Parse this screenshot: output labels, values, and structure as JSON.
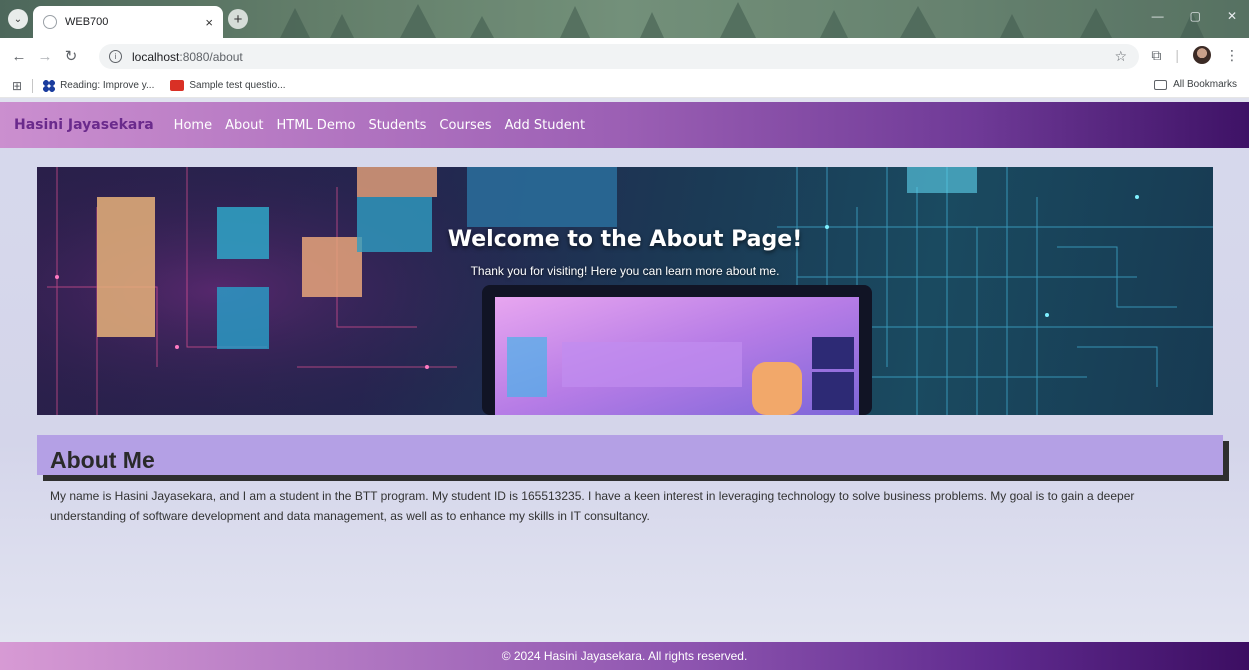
{
  "browser": {
    "tab_title": "WEB700",
    "tab_close": "×",
    "new_tab": "+",
    "url_host": "localhost",
    "url_path": ":8080/about",
    "bookmarks": [
      "Reading: Improve y...",
      "Sample test questio..."
    ],
    "all_bookmarks": "All Bookmarks"
  },
  "navbar": {
    "brand": "Hasini Jayasekara",
    "links": [
      "Home",
      "About",
      "HTML Demo",
      "Students",
      "Courses",
      "Add Student"
    ]
  },
  "hero": {
    "title": "Welcome to the About Page!",
    "subtitle": "Thank you for visiting! Here you can learn more about me."
  },
  "about": {
    "heading": "About Me",
    "text": "My name is Hasini Jayasekara, and I am a student in the BTT program. My student ID is 165513235. I have a keen interest in leveraging technology to solve business problems. My goal is to gain a deeper understanding of software development and data management, as well as to enhance my skills in IT consultancy."
  },
  "footer": {
    "text": "© 2024 Hasini Jayasekara. All rights reserved."
  },
  "colors": {
    "navbar_start": "#cb8fcf",
    "navbar_end": "#3e1266",
    "about_header": "#b4a0e5",
    "brand_text": "#6a2a8c"
  }
}
